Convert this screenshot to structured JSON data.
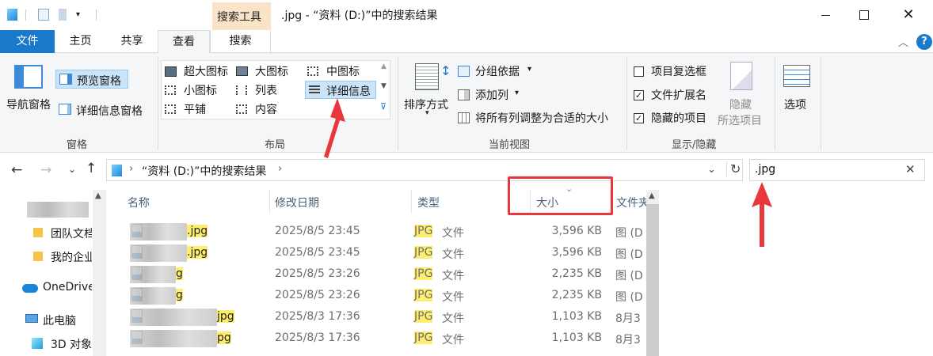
{
  "window": {
    "context_group": "搜索工具",
    "title": ".jpg - “资料 (D:)”中的搜索结果"
  },
  "tabs": [
    "文件",
    "主页",
    "共享",
    "查看",
    "搜索"
  ],
  "ribbon": {
    "pane_group": {
      "nav_pane": "导航窗格",
      "preview_pane": "预览窗格",
      "details_pane": "详细信息窗格",
      "label": "窗格"
    },
    "layout_group": {
      "items": [
        "超大图标",
        "大图标",
        "中图标",
        "小图标",
        "列表",
        "详细信息",
        "平铺",
        "内容"
      ],
      "label": "布局"
    },
    "view_group": {
      "sort": "排序方式",
      "group_by": "分组依据",
      "add_column": "添加列",
      "fit_columns": "将所有列调整为合适的大小",
      "label": "当前视图"
    },
    "show_group": {
      "item_checkboxes": "项目复选框",
      "file_extensions": "文件扩展名",
      "hidden_items": "隐藏的项目",
      "hide_line1": "隐藏",
      "hide_line2": "所选项目",
      "label": "显示/隐藏",
      "checked": {
        "item_checkboxes": false,
        "file_extensions": true,
        "hidden_items": true
      }
    },
    "options": "选项"
  },
  "address": {
    "path": "“资料 (D:)”中的搜索结果",
    "search_value": ".jpg"
  },
  "nav": {
    "items": [
      "团队文档",
      "我的企业",
      "OneDrive",
      "此电脑",
      "3D 对象"
    ]
  },
  "columns": {
    "name": "名称",
    "modified": "修改日期",
    "type": "类型",
    "size": "大小",
    "location": "文件夹"
  },
  "files": [
    {
      "name": ".jpg",
      "modified": "2025/8/5 23:45",
      "type_ext": "JPG",
      "type_word": "文件",
      "size": "3,596 KB",
      "loc": "图 (D"
    },
    {
      "name": ".jpg",
      "modified": "2025/8/5 23:45",
      "type_ext": "JPG",
      "type_word": "文件",
      "size": "3,596 KB",
      "loc": "图 (D"
    },
    {
      "name": "g",
      "modified": "2025/8/5 23:26",
      "type_ext": "JPG",
      "type_word": "文件",
      "size": "2,235 KB",
      "loc": "图 (D"
    },
    {
      "name": "g",
      "modified": "2025/8/5 23:26",
      "type_ext": "JPG",
      "type_word": "文件",
      "size": "2,235 KB",
      "loc": "图 (D"
    },
    {
      "name": "jpg",
      "modified": "2025/8/3 17:36",
      "type_ext": "JPG",
      "type_word": "文件",
      "size": "1,103 KB",
      "loc": "8月3"
    },
    {
      "name": "pg",
      "modified": "2025/8/3 17:36",
      "type_ext": "JPG",
      "type_word": "文件",
      "size": "1,103 KB",
      "loc": "8月3"
    }
  ],
  "colors": {
    "accent": "#1979ca",
    "highlight": "#ffee6e",
    "annotation": "#e8383d",
    "context_tab": "#fbe3c8"
  }
}
